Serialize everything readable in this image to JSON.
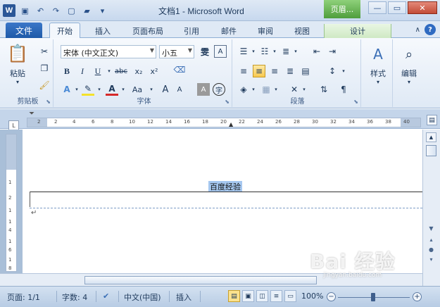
{
  "window": {
    "title": "文档1 - Microsoft Word",
    "context_group": "页眉...",
    "app_icon": "W"
  },
  "qat": [
    "save-icon",
    "undo-icon",
    "redo-icon",
    "new-doc-icon",
    "open-icon",
    "customize-icon"
  ],
  "tabs": {
    "file": "文件",
    "items": [
      "开始",
      "插入",
      "页面布局",
      "引用",
      "邮件",
      "审阅",
      "视图",
      "设计"
    ],
    "active": "开始"
  },
  "ribbon": {
    "clipboard": {
      "paste": "粘贴",
      "label": "剪贴板"
    },
    "font": {
      "name": "宋体 (中文正文)",
      "size": "小五",
      "bold": "B",
      "italic": "I",
      "underline": "U",
      "strike": "abc",
      "sub": "x₂",
      "sup": "x²",
      "grow": "A",
      "shrink": "A",
      "case": "Aa",
      "label": "字体"
    },
    "paragraph": {
      "label": "段落"
    },
    "styles": {
      "label": "样式"
    },
    "editing": {
      "label": "编辑"
    }
  },
  "ruler": {
    "ticks": [
      "2",
      "2",
      "4",
      "6",
      "8",
      "10",
      "12",
      "14",
      "16",
      "18",
      "20",
      "22",
      "24",
      "26",
      "28",
      "30",
      "32",
      "34",
      "36",
      "38",
      "40"
    ],
    "vticks": [
      "1",
      "2",
      "1",
      "1",
      "4",
      "1",
      "6",
      "1",
      "8"
    ]
  },
  "document": {
    "header_text": "百度经验",
    "para_mark": "↵"
  },
  "status": {
    "page": "页面: 1/1",
    "words": "字数: 4",
    "language": "中文(中国)",
    "mode": "插入",
    "zoom": "100%",
    "zoom_minus": "−",
    "zoom_plus": "+"
  },
  "watermark": {
    "brand": "Bai 经验",
    "url": "jingyan.baidu.com"
  }
}
